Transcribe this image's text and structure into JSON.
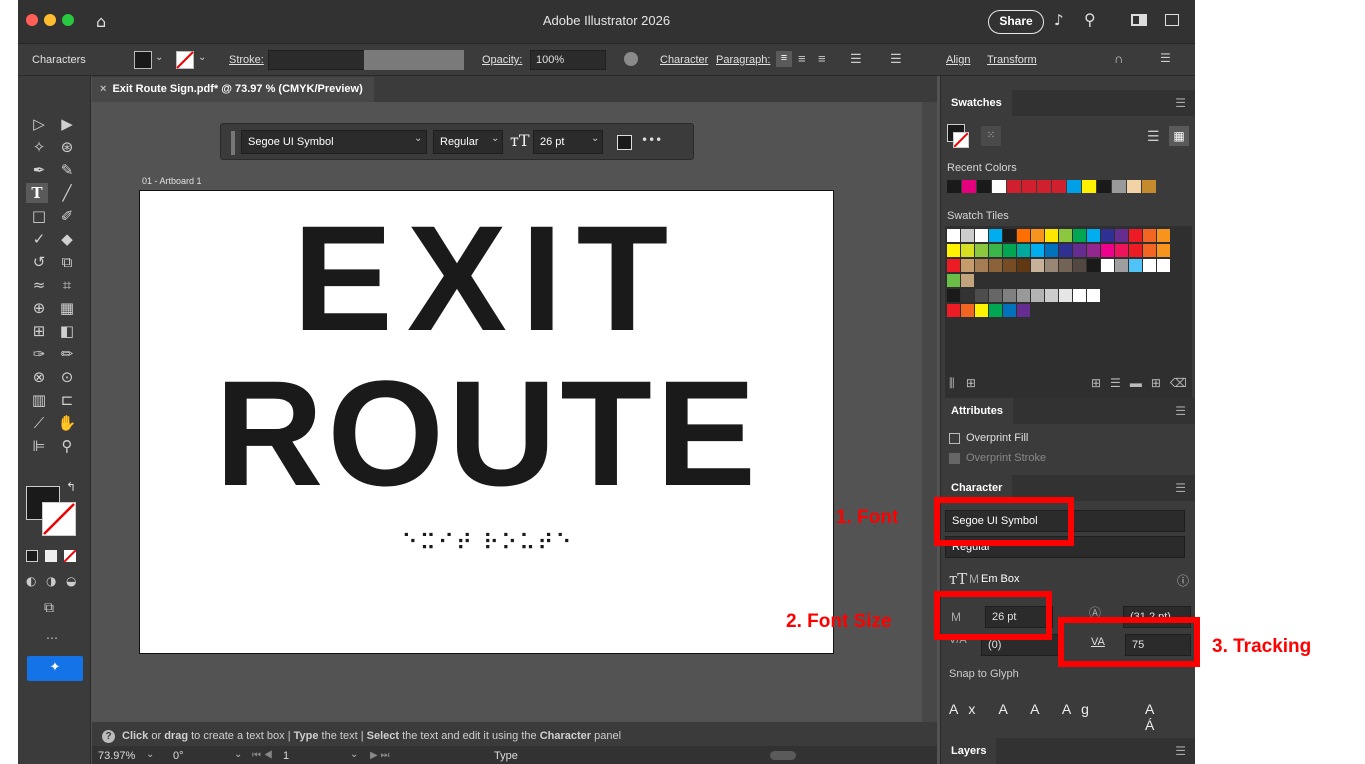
{
  "app": {
    "title": "Adobe Illustrator 2026",
    "share_label": "Share"
  },
  "control_bar": {
    "mode_label": "Characters",
    "stroke_label": "Stroke:",
    "opacity_label": "Opacity:",
    "opacity_value": "100%",
    "character_label": "Character",
    "paragraph_label": "Paragraph:",
    "align_label": "Align",
    "transform_label": "Transform"
  },
  "document_tab": {
    "label": "Exit Route Sign.pdf* @ 73.97 % (CMYK/Preview)",
    "close_glyph": "×"
  },
  "char_float_bar": {
    "font": "Segoe UI Symbol",
    "style": "Regular",
    "size": "26 pt",
    "more": "•••"
  },
  "artboard": {
    "label": "01 - Artboard 1",
    "line1": "EXIT",
    "line2": "ROUTE",
    "braille": "⠑⠭⠊⠞ ⠗⠕⠥⠞⠑"
  },
  "status_bar": {
    "hint_click": "Click",
    "hint_or_drag": " or ",
    "hint_drag": "drag",
    "hint_rest1": " to create a text box  |  ",
    "hint_type": "Type",
    "hint_rest2": " the text  |  ",
    "hint_select": "Select",
    "hint_rest3": " the text and edit it using the ",
    "hint_character": "Character",
    "hint_rest4": " panel",
    "zoom": "73.97%",
    "rotation": "0°",
    "artboard_num": "1",
    "tool_name": "Type"
  },
  "panels": {
    "swatches": {
      "title": "Swatches",
      "recent_colors_label": "Recent Colors",
      "swatch_tiles_label": "Swatch Tiles",
      "recent_colors": [
        "#1a1a1a",
        "#e4007c",
        "#1a1a1a",
        "#ffffff",
        "#d0202e",
        "#d0202e",
        "#d0202e",
        "#d0202e",
        "#00a0e9",
        "#fff000",
        "#1a1a1a",
        "#9a9a9a",
        "#f2d3a6",
        "#c68a2e"
      ]
    },
    "attributes": {
      "title": "Attributes",
      "overprint_fill": "Overprint Fill",
      "overprint_stroke": "Overprint Stroke"
    },
    "character": {
      "title": "Character",
      "font": "Segoe UI Symbol",
      "style": "Regular",
      "em_box": "Em Box",
      "font_size": "26 pt",
      "leading": "(31.2 pt)",
      "kerning": "(0)",
      "tracking": "75",
      "snap_to_glyph": "Snap to Glyph"
    },
    "layers": {
      "title": "Layers"
    }
  },
  "annotations": {
    "font": "1. Font",
    "font_size": "2. Font Size",
    "tracking": "3. Tracking"
  },
  "colors": {
    "annotation_red": "#ff0000",
    "selected_blue": "#1473e6"
  }
}
